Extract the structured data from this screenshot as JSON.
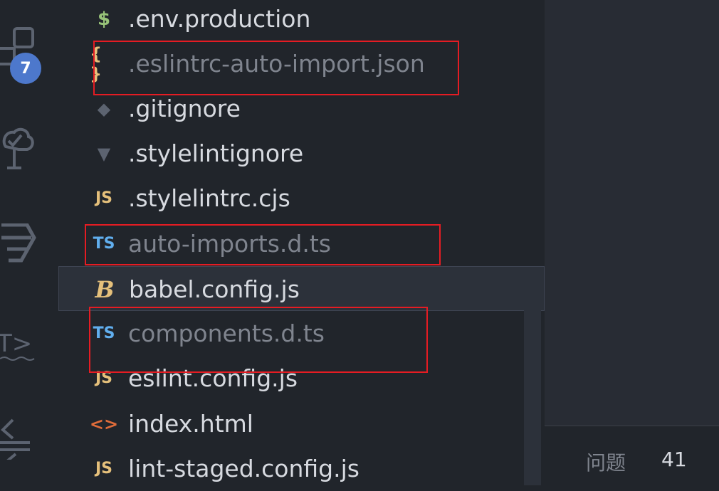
{
  "activity_bar": {
    "badge_count": "7",
    "icons": [
      "extensions-icon",
      "source-control-tree-icon",
      "stylelint-icon",
      "template-icon",
      "timeline-icon"
    ]
  },
  "explorer": {
    "files": [
      {
        "name": ".env.production",
        "icon": "dollar-icon",
        "glyph": "$",
        "color": "#98c379",
        "dim": false
      },
      {
        "name": ".eslintrc-auto-import.json",
        "icon": "json-icon",
        "glyph": "{ }",
        "color": "#e5c07b",
        "dim": true
      },
      {
        "name": ".gitignore",
        "icon": "git-icon",
        "glyph": "◆",
        "color": "#5c6370",
        "dim": false
      },
      {
        "name": ".stylelintignore",
        "icon": "stylelint-icon",
        "glyph": "▼",
        "color": "#5c6370",
        "dim": false
      },
      {
        "name": ".stylelintrc.cjs",
        "icon": "js-icon",
        "glyph": "JS",
        "color": "#e5c07b",
        "dim": false
      },
      {
        "name": "auto-imports.d.ts",
        "icon": "ts-icon",
        "glyph": "TS",
        "color": "#61afef",
        "dim": true
      },
      {
        "name": "babel.config.js",
        "icon": "babel-icon",
        "glyph": "B",
        "color": "#e5c07b",
        "dim": false
      },
      {
        "name": "components.d.ts",
        "icon": "ts-icon",
        "glyph": "TS",
        "color": "#61afef",
        "dim": true
      },
      {
        "name": "eslint.config.js",
        "icon": "js-icon",
        "glyph": "JS",
        "color": "#e5c07b",
        "dim": false
      },
      {
        "name": "index.html",
        "icon": "html-icon",
        "glyph": "<>",
        "color": "#e06c3a",
        "dim": false
      },
      {
        "name": "lint-staged.config.js",
        "icon": "js-icon",
        "glyph": "JS",
        "color": "#e5c07b",
        "dim": false
      }
    ]
  },
  "panel": {
    "problems_label": "问题",
    "problems_count": "41"
  },
  "colors": {
    "highlight": "#e51c23",
    "badge": "#4d78cc",
    "background": "#21252b"
  }
}
